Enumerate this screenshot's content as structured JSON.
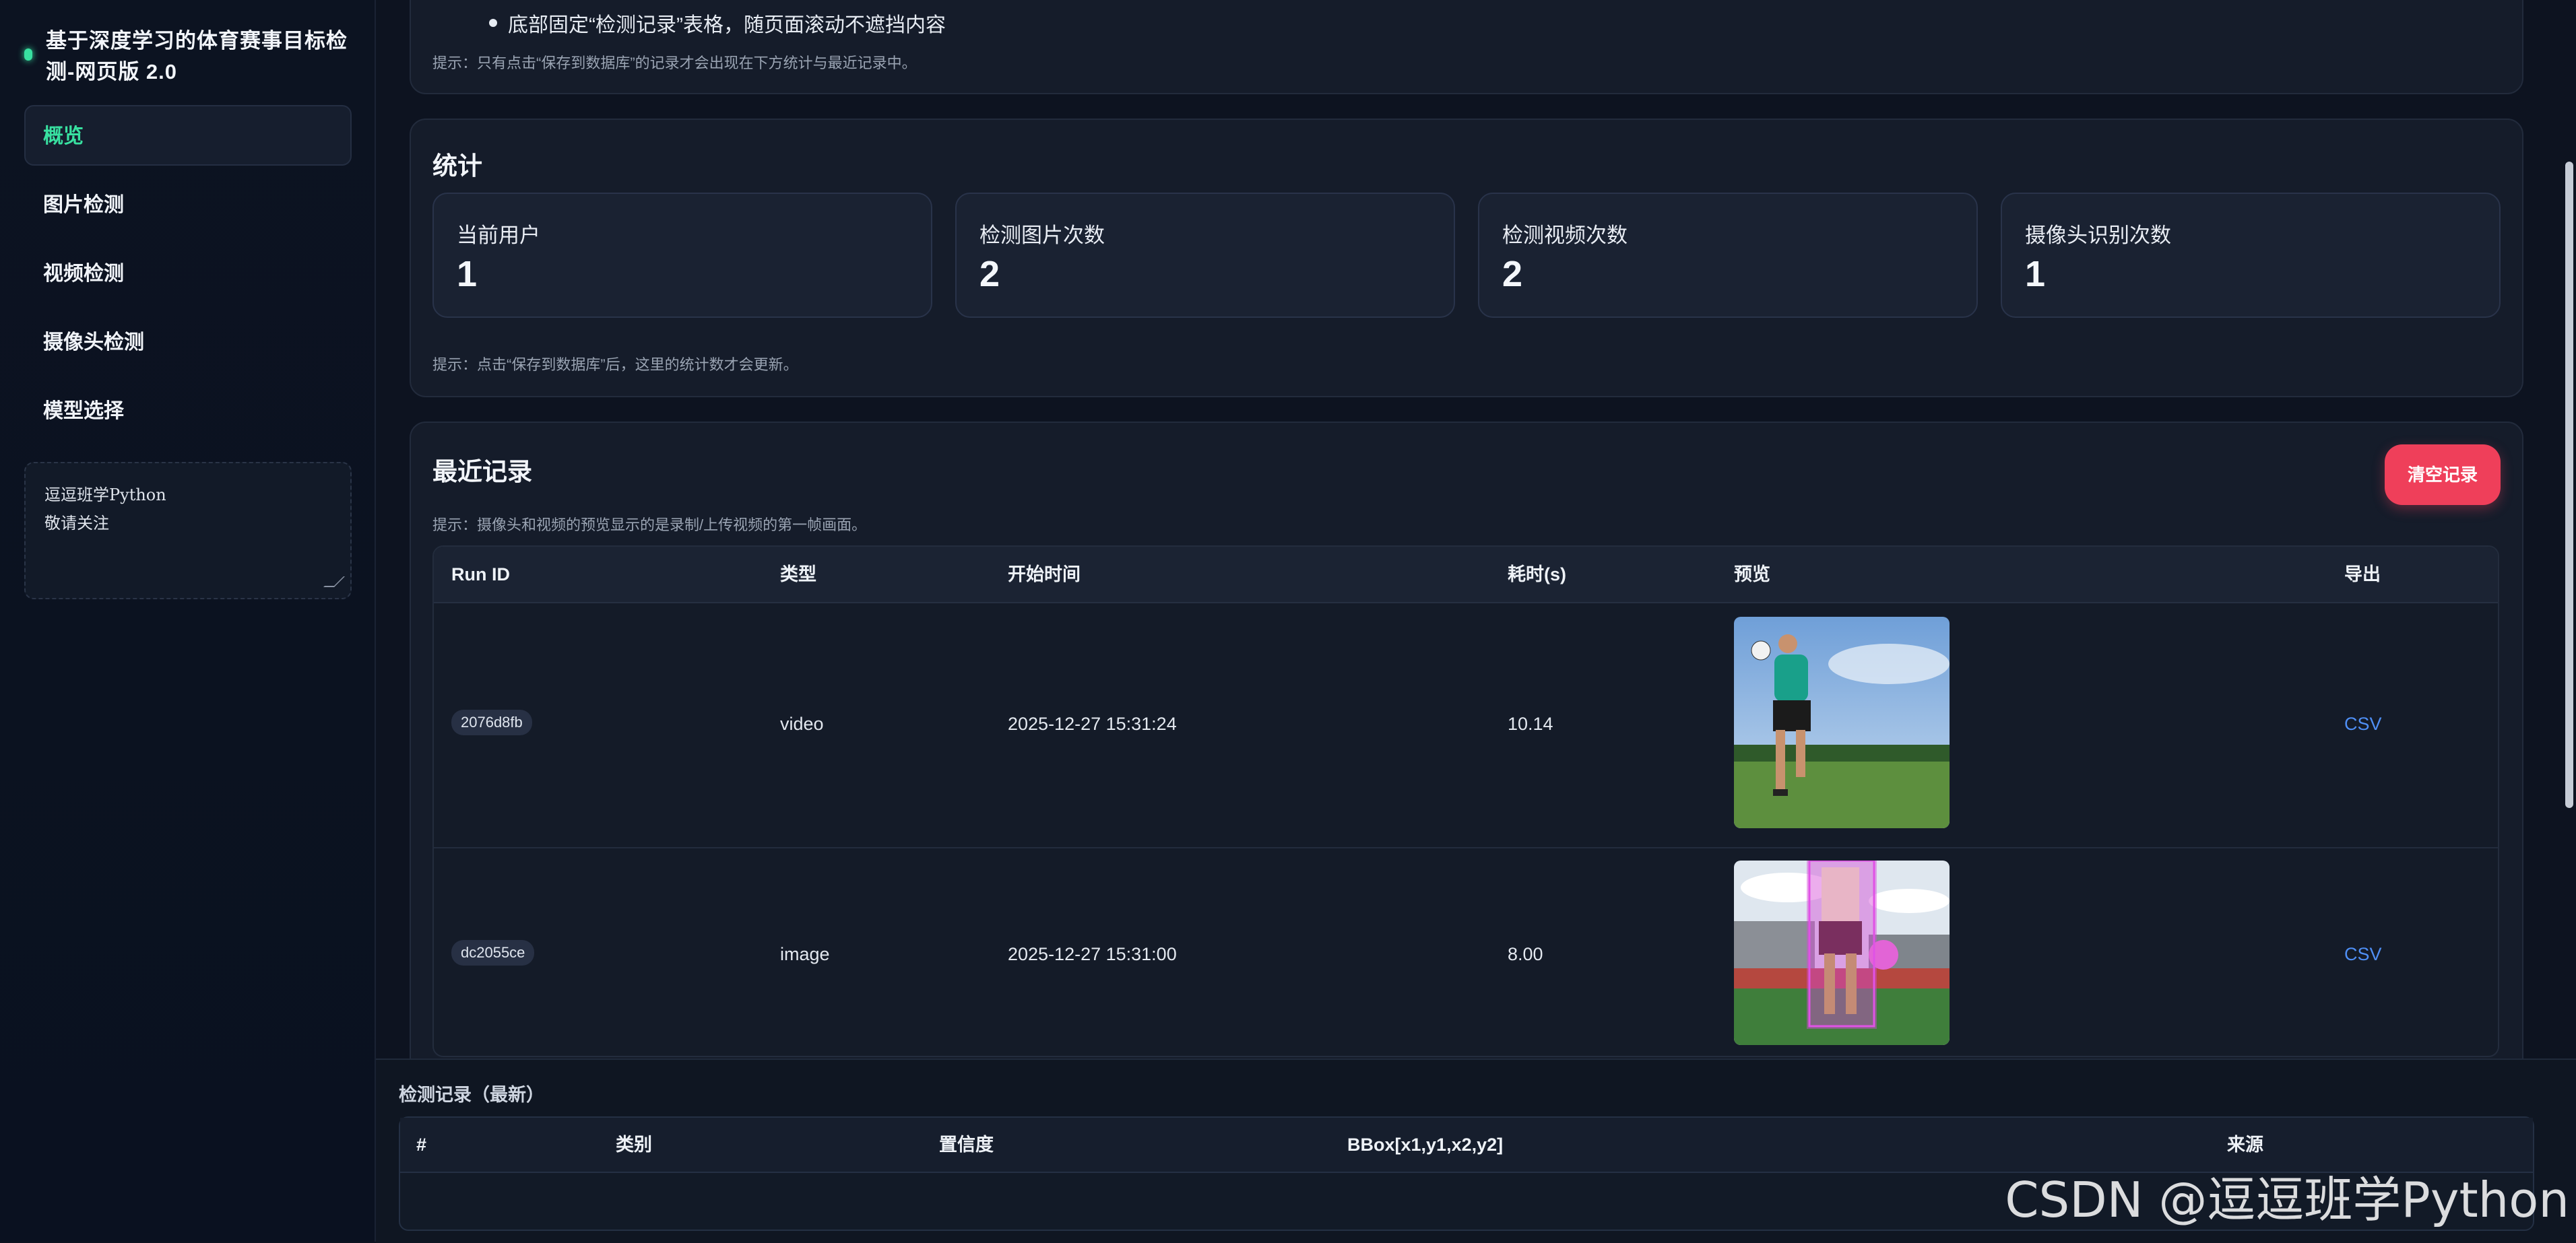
{
  "app": {
    "title": "基于深度学习的体育赛事目标检测-网页版 2.0"
  },
  "sidebar": {
    "items": [
      {
        "label": "概览",
        "active": true
      },
      {
        "label": "图片检测"
      },
      {
        "label": "视频检测"
      },
      {
        "label": "摄像头检测"
      },
      {
        "label": "模型选择"
      }
    ],
    "notes": [
      "逗逗班学Python",
      "敬请关注"
    ]
  },
  "top_section": {
    "bullet": "底部固定“检测记录”表格，随页面滚动不遮挡内容",
    "hint": "提示：只有点击“保存到数据库”的记录才会出现在下方统计与最近记录中。"
  },
  "stats": {
    "title": "统计",
    "cards": [
      {
        "label": "当前用户",
        "value": "1"
      },
      {
        "label": "检测图片次数",
        "value": "2"
      },
      {
        "label": "检测视频次数",
        "value": "2"
      },
      {
        "label": "摄像头识别次数",
        "value": "1"
      }
    ],
    "hint": "提示：点击“保存到数据库”后，这里的统计数才会更新。"
  },
  "recent": {
    "title": "最近记录",
    "clear_label": "清空记录",
    "hint": "提示：摄像头和视频的预览显示的是录制/上传视频的第一帧画面。",
    "columns": [
      "Run ID",
      "类型",
      "开始时间",
      "耗时(s)",
      "预览",
      "导出"
    ],
    "rows": [
      {
        "run_id": "2076d8fb",
        "type": "video",
        "start": "2025-12-27 15:31:24",
        "duration": "10.14",
        "export": "CSV"
      },
      {
        "run_id": "dc2055ce",
        "type": "image",
        "start": "2025-12-27 15:31:00",
        "duration": "8.00",
        "export": "CSV"
      }
    ]
  },
  "detections": {
    "title": "检测记录（最新）",
    "columns": [
      "#",
      "类别",
      "置信度",
      "BBox[x1,y1,x2,y2]",
      "来源"
    ]
  },
  "watermark": "CSDN @逗逗班学Python",
  "colors": {
    "accent": "#38e0a0",
    "danger": "#ef3f5a",
    "link": "#4f8ff5",
    "bg": "#0d1320"
  }
}
